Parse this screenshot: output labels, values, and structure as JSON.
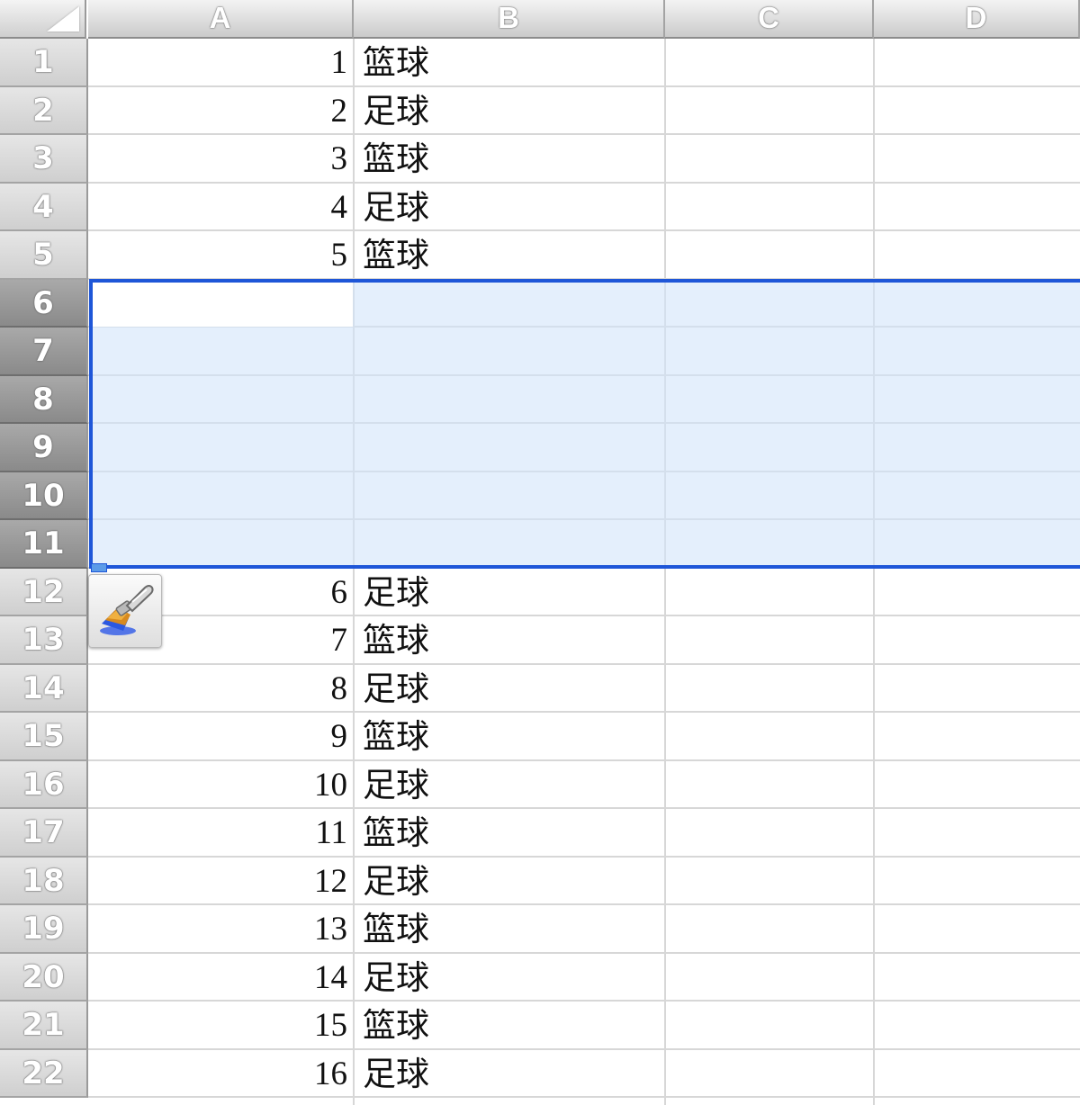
{
  "columns": [
    "A",
    "B",
    "C",
    "D"
  ],
  "row_numbers": [
    "1",
    "2",
    "3",
    "4",
    "5",
    "6",
    "7",
    "8",
    "9",
    "10",
    "11",
    "12",
    "13",
    "14",
    "15",
    "16",
    "17",
    "18",
    "19",
    "20",
    "21",
    "22"
  ],
  "selected_rows": [
    "6",
    "7",
    "8",
    "9",
    "10",
    "11"
  ],
  "rows": [
    {
      "row": "1",
      "a": "1",
      "b": "篮球"
    },
    {
      "row": "2",
      "a": "2",
      "b": "足球"
    },
    {
      "row": "3",
      "a": "3",
      "b": "篮球"
    },
    {
      "row": "4",
      "a": "4",
      "b": "足球"
    },
    {
      "row": "5",
      "a": "5",
      "b": "篮球"
    },
    {
      "row": "12",
      "a": "6",
      "b": "足球"
    },
    {
      "row": "13",
      "a": "7",
      "b": "篮球"
    },
    {
      "row": "14",
      "a": "8",
      "b": "足球"
    },
    {
      "row": "15",
      "a": "9",
      "b": "篮球"
    },
    {
      "row": "16",
      "a": "10",
      "b": "足球"
    },
    {
      "row": "17",
      "a": "11",
      "b": "篮球"
    },
    {
      "row": "18",
      "a": "12",
      "b": "足球"
    },
    {
      "row": "19",
      "a": "13",
      "b": "篮球"
    },
    {
      "row": "20",
      "a": "14",
      "b": "足球"
    },
    {
      "row": "21",
      "a": "15",
      "b": "篮球"
    },
    {
      "row": "22",
      "a": "16",
      "b": "足球"
    }
  ],
  "paste_options_icon": "paintbrush-icon",
  "colors": {
    "selection_border": "#1e56d8",
    "selection_fill": "#e3eefc",
    "header_gray": "#cfcfcf",
    "selected_header_gray": "#8a8a8a"
  }
}
